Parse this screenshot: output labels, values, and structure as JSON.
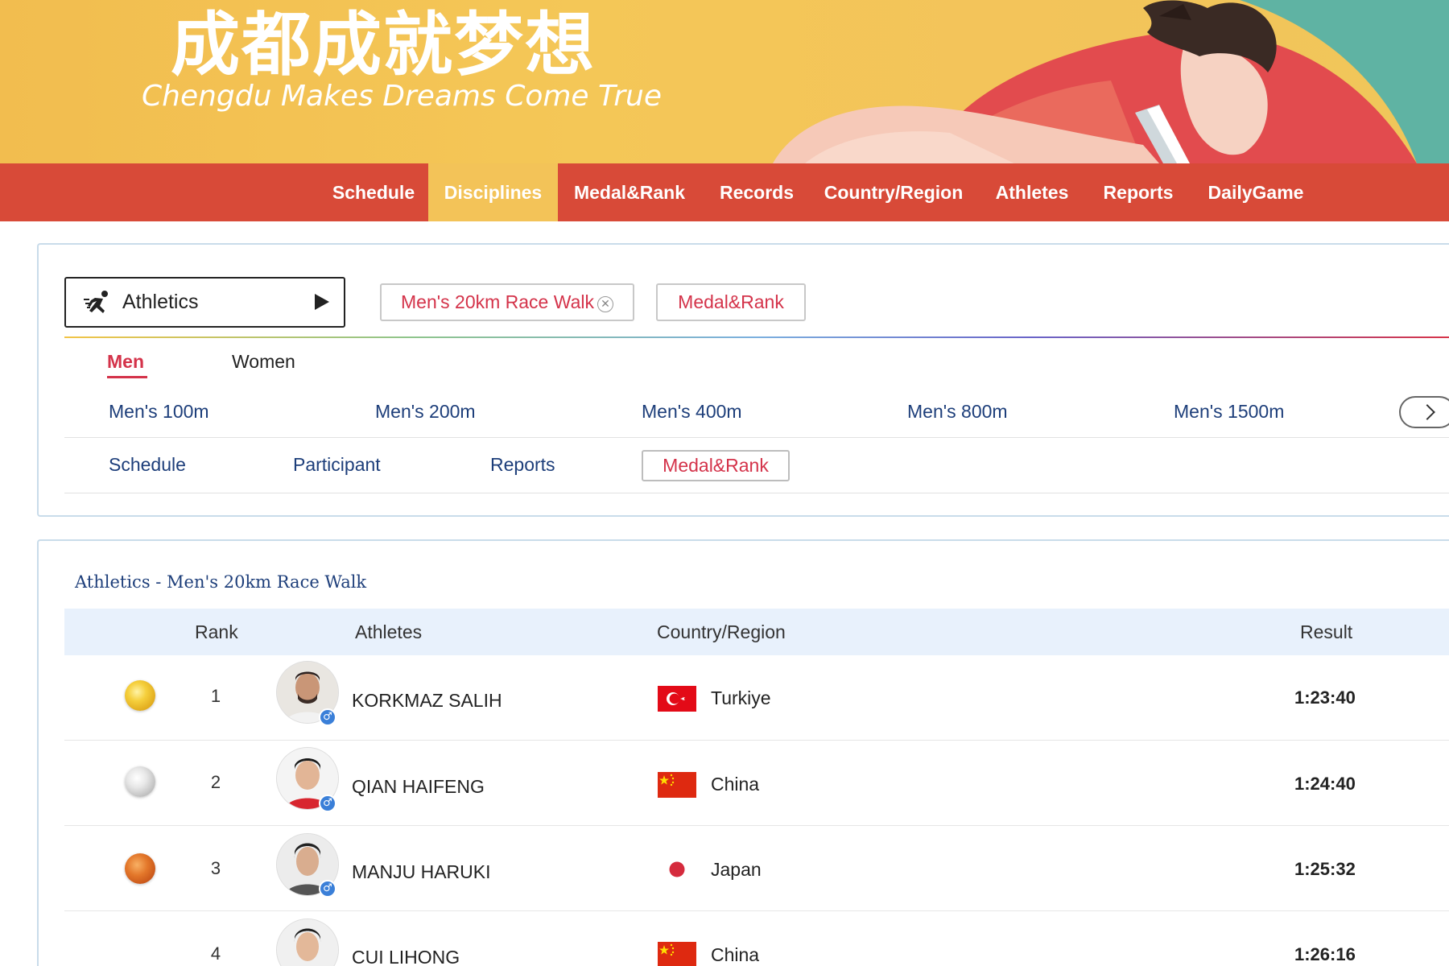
{
  "banner": {
    "title_cn": "成都成就梦想",
    "title_en": "Chengdu Makes Dreams Come True"
  },
  "nav": {
    "items": [
      {
        "label": "Schedule",
        "active": false
      },
      {
        "label": "Disciplines",
        "active": true
      },
      {
        "label": "Medal&Rank",
        "active": false
      },
      {
        "label": "Records",
        "active": false
      },
      {
        "label": "Country/Region",
        "active": false
      },
      {
        "label": "Athletes",
        "active": false
      },
      {
        "label": "Reports",
        "active": false
      },
      {
        "label": "DailyGame",
        "active": false
      }
    ]
  },
  "filters": {
    "sport": "Athletics",
    "event_chip": "Men's 20km Race Walk",
    "view_chip": "Medal&Rank"
  },
  "gender_tabs": [
    {
      "label": "Men",
      "active": true
    },
    {
      "label": "Women",
      "active": false
    }
  ],
  "events": [
    "Men's 100m",
    "Men's 200m",
    "Men's 400m",
    "Men's 800m",
    "Men's 1500m"
  ],
  "sub_tabs": [
    {
      "label": "Schedule",
      "active": false
    },
    {
      "label": "Participant",
      "active": false
    },
    {
      "label": "Reports",
      "active": false
    },
    {
      "label": "Medal&Rank",
      "active": true
    }
  ],
  "results": {
    "title": "Athletics - Men's 20km Race Walk",
    "columns": {
      "rank": "Rank",
      "athletes": "Athletes",
      "country": "Country/Region",
      "result": "Result"
    },
    "rows": [
      {
        "medal": "gold",
        "rank": "1",
        "name": "KORKMAZ SALIH",
        "country": "Turkiye",
        "flag": "turkey-flag",
        "result": "1:23:40"
      },
      {
        "medal": "silver",
        "rank": "2",
        "name": "QIAN HAIFENG",
        "country": "China",
        "flag": "china-flag",
        "result": "1:24:40"
      },
      {
        "medal": "bronze",
        "rank": "3",
        "name": "MANJU HARUKI",
        "country": "Japan",
        "flag": "japan-flag",
        "result": "1:25:32"
      },
      {
        "medal": "",
        "rank": "4",
        "name": "CUI LIHONG",
        "country": "China",
        "flag": "china-flag",
        "result": "1:26:16"
      }
    ]
  },
  "colors": {
    "nav_red": "#d84a38",
    "nav_active": "#f3c358",
    "accent_red": "#d4334a",
    "link_navy": "#1d3e7a",
    "table_header": "#e8f1fc"
  }
}
